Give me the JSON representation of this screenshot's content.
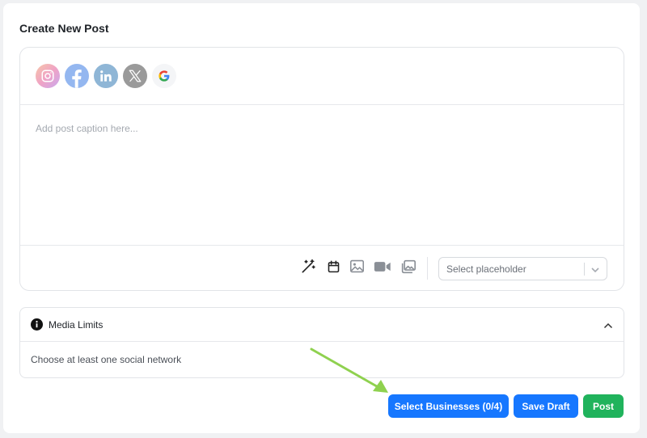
{
  "page": {
    "title": "Create New Post"
  },
  "networks": [
    {
      "icon": "instagram-icon",
      "color": "#e1306c"
    },
    {
      "icon": "facebook-icon",
      "color": "#1877f2"
    },
    {
      "icon": "linkedin-icon",
      "color": "#0a66c2"
    },
    {
      "icon": "x-icon",
      "color": "#000000"
    },
    {
      "icon": "google-icon",
      "color": "#4285f4"
    }
  ],
  "composer": {
    "caption_placeholder": "Add post caption here...",
    "caption_value": "",
    "toolbar_icons": [
      "magic-wand-icon",
      "calendar-icon",
      "image-icon",
      "video-icon",
      "gallery-icon"
    ],
    "placeholder_select": {
      "text": "Select placeholder"
    }
  },
  "media_limits": {
    "title": "Media Limits",
    "body": "Choose at least one social network"
  },
  "actions": {
    "select_businesses": "Select Businesses (0/4)",
    "save_draft": "Save Draft",
    "post": "Post"
  },
  "colors": {
    "primary": "#1677ff",
    "success": "#20b35c",
    "annotation_arrow": "#8fd14f"
  }
}
